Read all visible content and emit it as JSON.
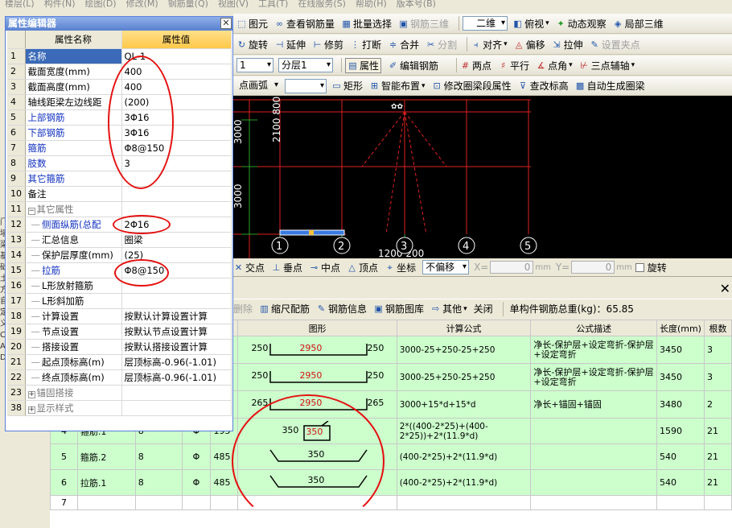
{
  "menu": {
    "items": [
      "楼层(L)",
      "构件(N)",
      "绘图(D)",
      "修改(M)",
      "钢筋量(Q)",
      "视图(V)",
      "工具(T)",
      "在线服务(S)",
      "帮助(H)",
      "版本号(B)"
    ]
  },
  "toolbar1": {
    "items": [
      "图元",
      "查看钢筋量",
      "批量选择",
      "钢筋三维",
      "二维",
      "俯视",
      "动态观察",
      "局部三维"
    ]
  },
  "toolbar2": {
    "items": [
      "旋转",
      "延伸",
      "修剪",
      "打断",
      "合并",
      "分割",
      "对齐",
      "偏移",
      "拉伸",
      "设置夹点"
    ]
  },
  "toolbar3": {
    "combo1": "1",
    "combo2": "分层1",
    "btn_attr": "属性",
    "btn_edit": "编辑钢筋",
    "items": [
      "两点",
      "平行",
      "点角",
      "三点辅轴"
    ]
  },
  "toolbar4": {
    "combo1": "点画弧",
    "combo2": "",
    "items": [
      "矩形",
      "智能布置",
      "修改圈梁段属性",
      "查改标高",
      "自动生成圈梁"
    ]
  },
  "canvas": {
    "dim_left_upper": "3000",
    "dim_left_lower": "3000",
    "dim_vertical": "2100 800",
    "dim_bottom": "1200 200",
    "axis_labels": [
      "1",
      "2",
      "3",
      "4",
      "5"
    ]
  },
  "snapbar": {
    "items": [
      "交点",
      "垂点",
      "中点",
      "顶点",
      "坐标"
    ],
    "offset_combo": "不偏移",
    "x_label": "X=",
    "x_value": "0",
    "y_label": "Y=",
    "y_value": "0",
    "unit": "mm",
    "rotate": "旋转"
  },
  "rebar_toolbar": {
    "items": [
      "删除",
      "缩尺配筋",
      "钢筋信息",
      "钢筋图库",
      "其他",
      "关闭"
    ],
    "total": "单构件钢筋总重(kg)：65.85"
  },
  "rebar_table": {
    "headers": [
      "图形",
      "计算公式",
      "公式描述",
      "长度(mm)",
      "根数"
    ],
    "rows": [
      {
        "num": "",
        "name": "",
        "dia": "",
        "grade": "",
        "code": "",
        "left": "250",
        "shape": "2950",
        "right": "250",
        "formula": "3000-25+250-25+250",
        "desc": "净长-保护层+设定弯折-保护层+设定弯折",
        "len": "3450",
        "count": "3"
      },
      {
        "num": "",
        "name": "",
        "dia": "",
        "grade": "",
        "code": "",
        "left": "250",
        "shape": "2950",
        "right": "250",
        "formula": "3000-25+250-25+250",
        "desc": "净长-保护层+设定弯折-保护层+设定弯折",
        "len": "3450",
        "count": "3"
      },
      {
        "num": "",
        "name": "",
        "dia": "",
        "grade": "",
        "code": "",
        "left": "265",
        "shape": "2950",
        "right": "265",
        "formula": "3000+15*d+15*d",
        "desc": "净长+锚固+锚固",
        "len": "3480",
        "count": "2"
      },
      {
        "num": "4",
        "name": "箍筋.1",
        "dia": "8",
        "grade": "Φ",
        "code": "195",
        "left": "350",
        "shape": "350",
        "right": "",
        "formula": "2*((400-2*25)+(400-2*25))+2*(11.9*d)",
        "desc": "",
        "len": "1590",
        "count": "21"
      },
      {
        "num": "5",
        "name": "箍筋.2",
        "dia": "8",
        "grade": "Φ",
        "code": "485",
        "left": "",
        "shape": "350",
        "right": "",
        "formula": "(400-2*25)+2*(11.9*d)",
        "desc": "",
        "len": "540",
        "count": "21"
      },
      {
        "num": "6",
        "name": "拉筋.1",
        "dia": "8",
        "grade": "Φ",
        "code": "485",
        "left": "",
        "shape": "350",
        "right": "",
        "formula": "(400-2*25)+2*(11.9*d)",
        "desc": "",
        "len": "540",
        "count": "21"
      },
      {
        "num": "7",
        "name": "",
        "dia": "",
        "grade": "",
        "code": "",
        "left": "",
        "shape": "",
        "right": "",
        "formula": "",
        "desc": "",
        "len": "",
        "count": ""
      }
    ]
  },
  "property_editor": {
    "title": "属性编辑器",
    "col_name": "属性名称",
    "col_value": "属性值",
    "rows": [
      {
        "n": "1",
        "name": "名称",
        "value": "QL-1",
        "style": "blue"
      },
      {
        "n": "2",
        "name": "截面宽度(mm)",
        "value": "400",
        "style": ""
      },
      {
        "n": "3",
        "name": "截面高度(mm)",
        "value": "400",
        "style": ""
      },
      {
        "n": "4",
        "name": "轴线距梁左边线距",
        "value": "(200)",
        "style": ""
      },
      {
        "n": "5",
        "name": "上部钢筋",
        "value": "3Φ16",
        "style": "blue"
      },
      {
        "n": "6",
        "name": "下部钢筋",
        "value": "3Φ16",
        "style": "blue"
      },
      {
        "n": "7",
        "name": "箍筋",
        "value": "Φ8@150",
        "style": "blue"
      },
      {
        "n": "8",
        "name": "肢数",
        "value": "3",
        "style": "blue"
      },
      {
        "n": "9",
        "name": "其它箍筋",
        "value": "",
        "style": "blue"
      },
      {
        "n": "10",
        "name": "备注",
        "value": "",
        "style": ""
      },
      {
        "n": "11",
        "name": "其它属性",
        "value": "",
        "style": "grey",
        "tree": "−"
      },
      {
        "n": "12",
        "name": "侧面纵筋(总配",
        "value": "2Φ16",
        "style": "blue",
        "indent": true
      },
      {
        "n": "13",
        "name": "汇总信息",
        "value": "圈梁",
        "style": "",
        "indent": true
      },
      {
        "n": "14",
        "name": "保护层厚度(mm)",
        "value": "(25)",
        "style": "",
        "indent": true
      },
      {
        "n": "15",
        "name": "拉筋",
        "value": "Φ8@150",
        "style": "blue",
        "indent": true
      },
      {
        "n": "16",
        "name": "L形放射箍筋",
        "value": "",
        "style": "",
        "indent": true
      },
      {
        "n": "17",
        "name": "L形斜加筋",
        "value": "",
        "style": "",
        "indent": true
      },
      {
        "n": "18",
        "name": "计算设置",
        "value": "按默认计算设置计算",
        "style": "",
        "indent": true
      },
      {
        "n": "19",
        "name": "节点设置",
        "value": "按默认节点设置计算",
        "style": "",
        "indent": true
      },
      {
        "n": "20",
        "name": "搭接设置",
        "value": "按默认搭接设置计算",
        "style": "",
        "indent": true
      },
      {
        "n": "21",
        "name": "起点顶标高(m)",
        "value": "层顶标高-0.96(-1.01)",
        "style": "",
        "indent": true
      },
      {
        "n": "22",
        "name": "终点顶标高(m)",
        "value": "层顶标高-0.96(-1.01)",
        "style": "",
        "indent": true
      },
      {
        "n": "23",
        "name": "锚固搭接",
        "value": "",
        "style": "grey",
        "tree": "+"
      },
      {
        "n": "38",
        "name": "显示样式",
        "value": "",
        "style": "grey",
        "tree": "+"
      }
    ]
  },
  "left_strip": {
    "chars": [
      "门",
      "墙",
      "梁",
      "基",
      "础",
      "土",
      "方",
      "自",
      "定",
      "义",
      "C",
      "A",
      "D"
    ]
  },
  "colors": {
    "accent_blue": "#3a6ab8",
    "annotation_red": "#e41010",
    "row_green": "#ccffcc",
    "header_orange": "#ffc84a"
  }
}
